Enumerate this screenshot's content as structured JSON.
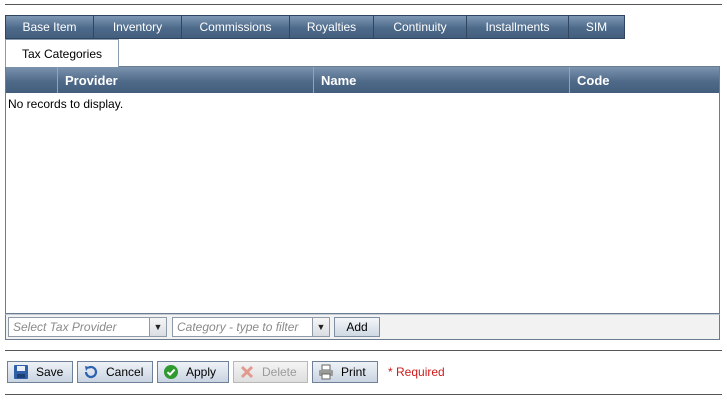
{
  "tabs": {
    "row1": [
      "Base Item",
      "Inventory",
      "Commissions",
      "Royalties",
      "Continuity",
      "Installments",
      "SIM"
    ],
    "active": "Tax Categories"
  },
  "grid": {
    "columns": [
      "",
      "Provider",
      "Name",
      "Code"
    ],
    "empty_text": "No records to display."
  },
  "filter": {
    "provider_placeholder": "Select Tax Provider",
    "category_placeholder": "Category - type to filter",
    "add_label": "Add"
  },
  "actions": {
    "save": "Save",
    "cancel": "Cancel",
    "apply": "Apply",
    "delete": "Delete",
    "print": "Print",
    "required_note": "* Required"
  }
}
